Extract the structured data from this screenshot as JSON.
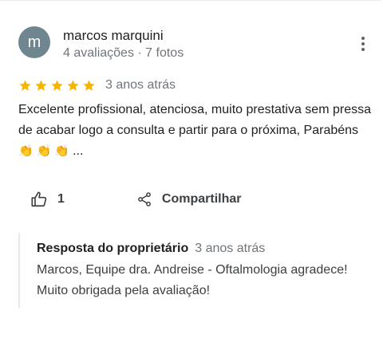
{
  "review": {
    "avatar_letter": "m",
    "author_name": "marcos marquini",
    "author_meta": "4 avaliações · 7 fotos",
    "rating": 5,
    "rating_max": 5,
    "date": "3 anos atrás",
    "text": "Excelente profissional, atenciosa, muito prestativa sem pressa de acabar logo a consulta e partir para o próxima, Parabéns",
    "emoji": [
      "👏",
      "👏",
      "👏"
    ],
    "ellipsis": "...",
    "more_icon": "more-vert-icon"
  },
  "actions": {
    "like_icon": "thumb-up-icon",
    "like_count": "1",
    "share_icon": "share-icon",
    "share_label": "Compartilhar"
  },
  "owner_response": {
    "title": "Resposta do proprietário",
    "date": "3 anos atrás",
    "text": "Marcos, Equipe dra. Andreise - Oftalmologia agradece! Muito obrigada pela avaliação!"
  },
  "colors": {
    "star": "#f4b400",
    "avatar_bg": "#6f8690",
    "meta_text": "#70757a",
    "divider": "#e8eaed"
  }
}
